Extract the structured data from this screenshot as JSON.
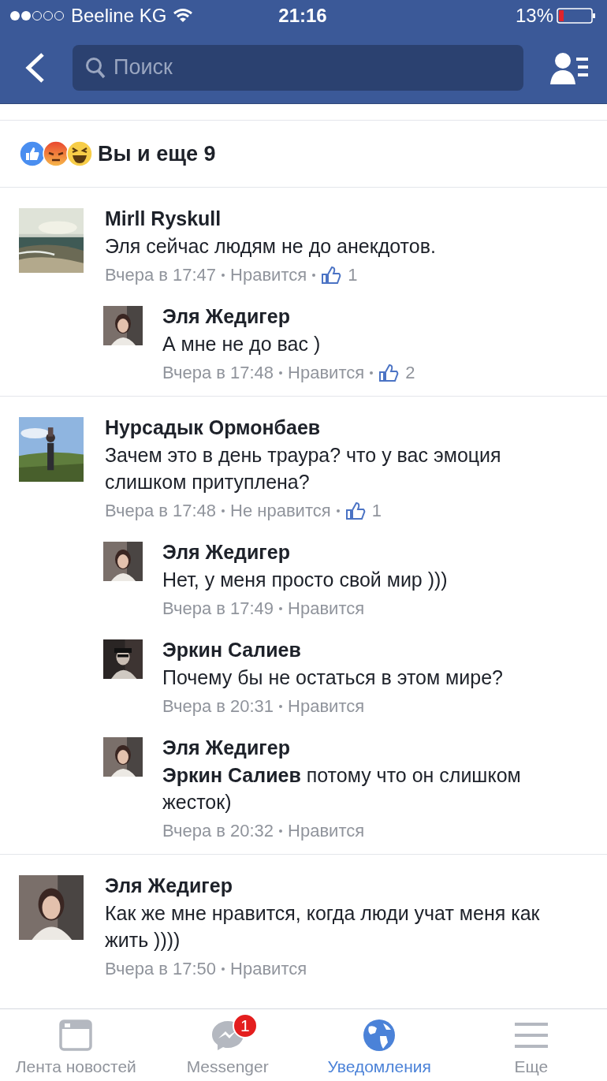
{
  "status_bar": {
    "carrier": "Beeline KG",
    "time": "21:16",
    "battery": "13%"
  },
  "nav_bar": {
    "search": {
      "placeholder": "Поиск"
    }
  },
  "reactions": {
    "summary": "Вы и еще 9"
  },
  "comments": [
    {
      "author": "Mirll Ryskull",
      "text": "Эля сейчас людям не до анекдотов.",
      "time": "Вчера в 17:47",
      "action": "Нравится",
      "likes": "1",
      "replies": [
        {
          "author": "Эля Жедигер",
          "text": "А мне не до вас )",
          "time": "Вчера в 17:48",
          "action": "Нравится",
          "likes": "2"
        }
      ]
    },
    {
      "author": "Нурсадык Ормонбаев",
      "text": "Зачем это в день траура? что у вас эмоция слишком притуплена?",
      "time": "Вчера в 17:48",
      "action": "Не нравится",
      "likes": "1",
      "replies": [
        {
          "author": "Эля Жедигер",
          "text": "Нет, у меня просто свой мир )))",
          "time": "Вчера в 17:49",
          "action": "Нравится"
        },
        {
          "author": "Эркин Салиев",
          "text": "Почему бы не остаться в этом мире?",
          "time": "Вчера в 20:31",
          "action": "Нравится"
        },
        {
          "author": "Эля Жедигер",
          "text": "**Эркин Салиев** потому что он слишком жесток)",
          "time": "Вчера в 20:32",
          "action": "Нравится"
        }
      ]
    },
    {
      "author": "Эля Жедигер",
      "text": "Как же мне нравится, когда люди учат меня как жить ))))",
      "time": "Вчера в 17:50",
      "action": "Нравится"
    }
  ],
  "tab_bar": [
    {
      "kind": "news",
      "label": "Лента новостей",
      "selected": false
    },
    {
      "kind": "messenger",
      "label": "Messenger",
      "selected": false,
      "badge": "1"
    },
    {
      "kind": "globe",
      "label": "Уведомления",
      "selected": true
    },
    {
      "kind": "menu",
      "label": "Еще",
      "selected": false
    }
  ]
}
